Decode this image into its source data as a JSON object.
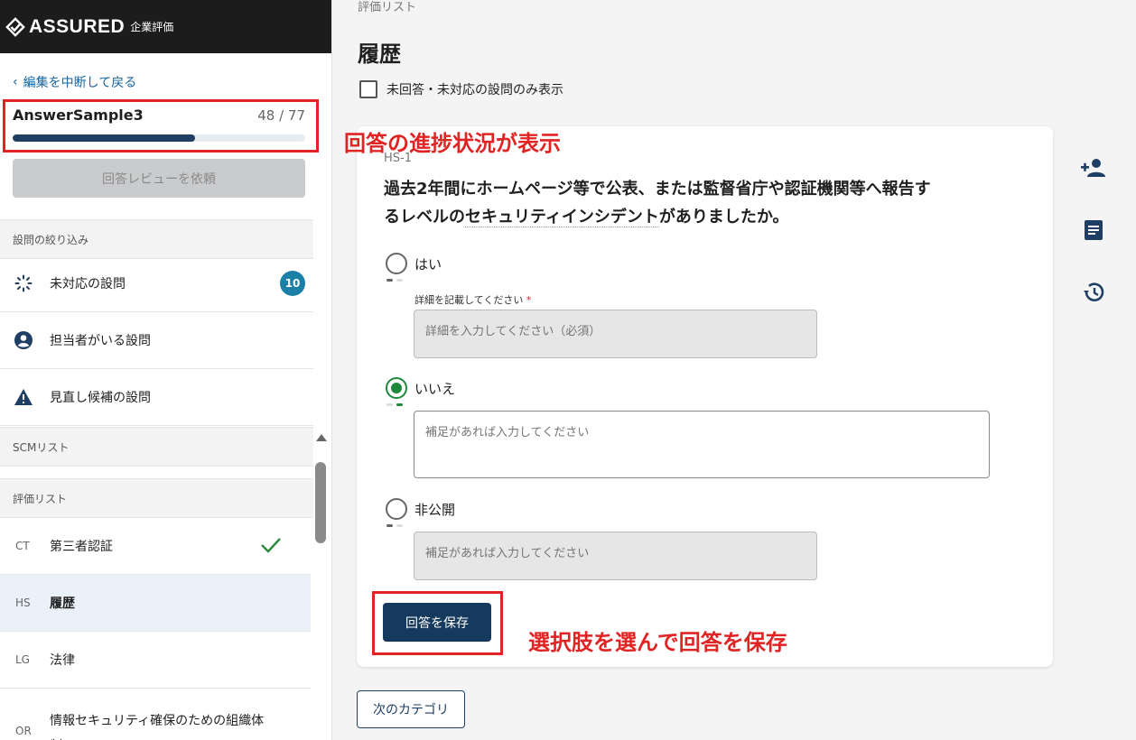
{
  "brand": {
    "name": "ASSURED",
    "sub": "企業評価"
  },
  "sidebar": {
    "back_label": "編集を中断して戻る",
    "project": {
      "name": "AnswerSample3",
      "answered": 48,
      "total": 77,
      "count_text": "48 / 77",
      "progress_fraction": 0.623
    },
    "review_button": "回答レビューを依頼",
    "filter_section": "設問の絞り込み",
    "filters": [
      {
        "label": "未対応の設問",
        "badge": "10",
        "icon": "loading-icon"
      },
      {
        "label": "担当者がいる設問",
        "icon": "person-icon"
      },
      {
        "label": "見直し候補の設問",
        "icon": "warning-icon"
      }
    ],
    "scm_section": "SCMリスト",
    "eval_section": "評価リスト",
    "categories": [
      {
        "code": "CT",
        "label": "第三者認証",
        "done": true
      },
      {
        "code": "HS",
        "label": "履歴",
        "active": true
      },
      {
        "code": "LG",
        "label": "法律"
      },
      {
        "code": "OR",
        "label": "情報セキュリティ確保のための組織体制"
      }
    ]
  },
  "main": {
    "breadcrumb": "評価リスト",
    "title": "履歴",
    "unanswered_only_label": "未回答・未対応の設問のみ表示",
    "question": {
      "code": "HS-1",
      "text_line1": "過去2年間にホームページ等で公表、または監督省庁や認証機関等へ報告す",
      "text_line2_pre": "るレベルの",
      "text_line2_term": "セキュリティインシデント",
      "text_line2_post": "がありましたか。",
      "options": [
        {
          "label": "はい",
          "selected": false
        },
        {
          "label": "いいえ",
          "selected": true
        },
        {
          "label": "非公開",
          "selected": false
        }
      ],
      "detail_label": "詳細を記載してください",
      "detail_required_mark": "*",
      "detail_placeholder": "詳細を入力してください（必須）",
      "note_placeholder_no": "補足があれば入力してください",
      "note_placeholder_private": "補足があれば入力してください"
    },
    "save_button": "回答を保存",
    "next_button": "次のカテゴリ"
  },
  "annotations": {
    "progress_note": "回答の進捗状況が表示",
    "save_note": "選択肢を選んで回答を保存"
  },
  "colors": {
    "accent": "#153a5e",
    "selected": "#1c8a3a",
    "badge": "#1b7fa6",
    "annotation": "#e02424"
  }
}
